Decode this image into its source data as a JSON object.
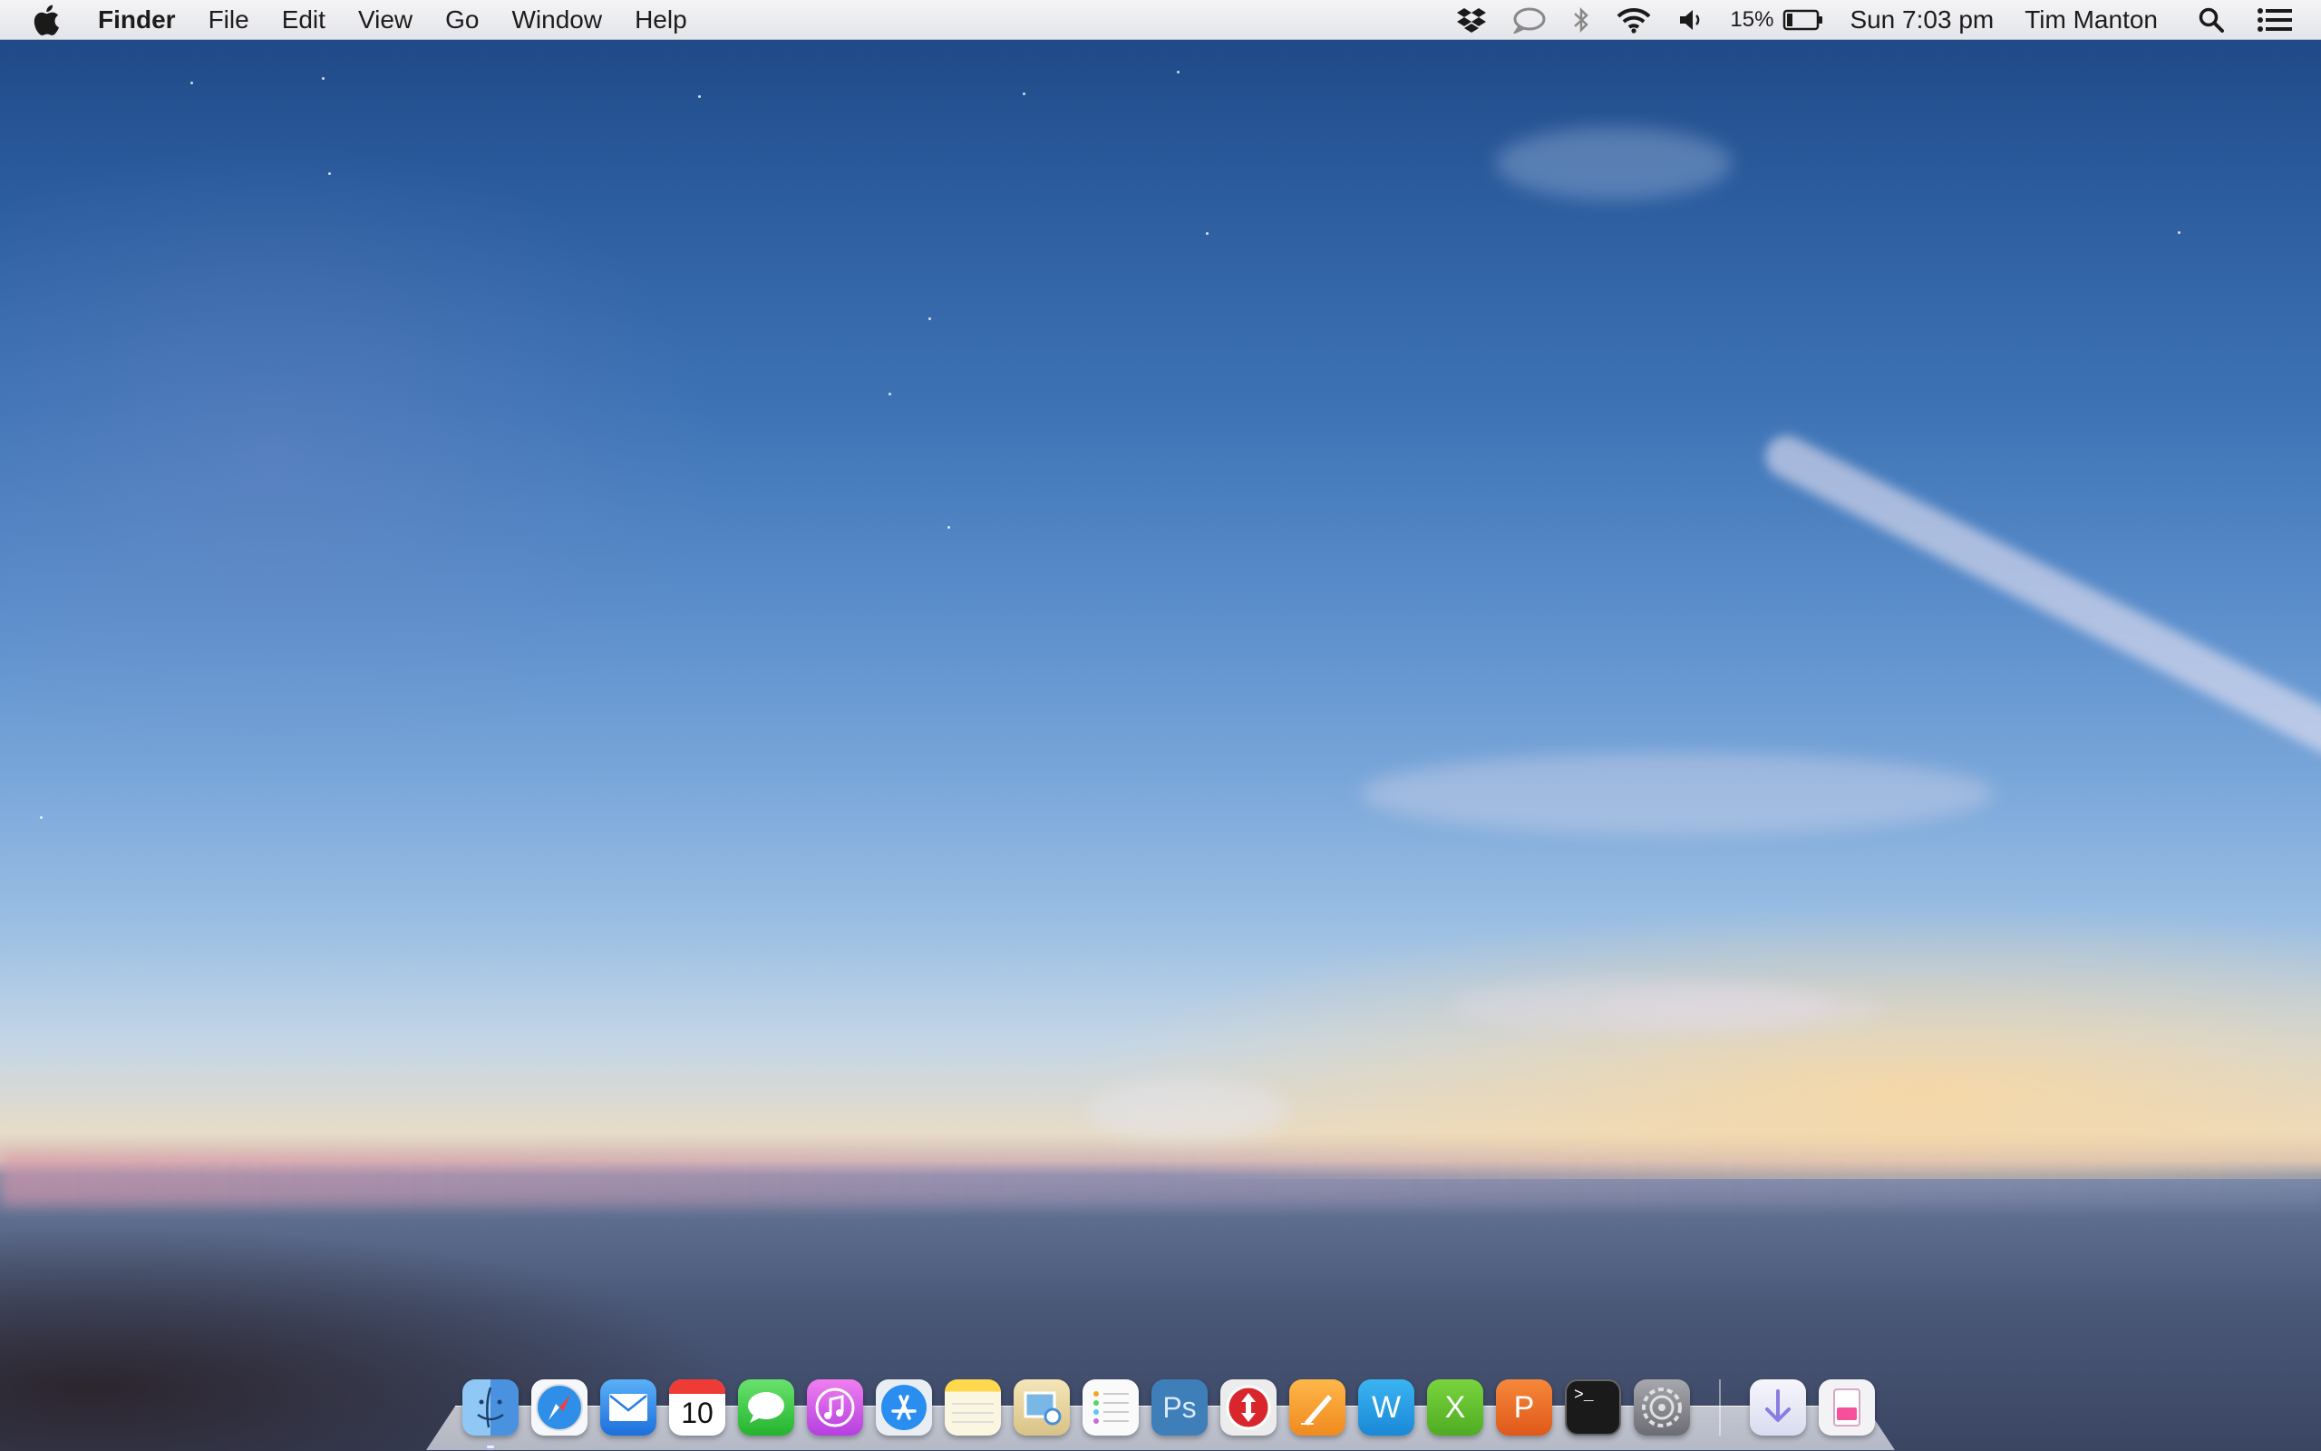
{
  "menubar": {
    "apple_icon": "apple-logo",
    "app_name": "Finder",
    "menus": [
      "File",
      "Edit",
      "View",
      "Go",
      "Window",
      "Help"
    ],
    "status_icons": [
      "dropbox-icon",
      "messages-status-icon",
      "bluetooth-icon",
      "wifi-icon",
      "volume-icon"
    ],
    "battery_percent": "15%",
    "clock": "Sun 7:03 pm",
    "user_name": "Tim Manton",
    "spotlight_icon": "search-icon",
    "notification_icon": "notification-center-icon"
  },
  "dock": {
    "apps": [
      {
        "name": "Finder",
        "icon": "finder-icon"
      },
      {
        "name": "Safari",
        "icon": "safari-icon"
      },
      {
        "name": "Mail",
        "icon": "mail-icon"
      },
      {
        "name": "Calendar",
        "icon": "calendar-icon",
        "date": "10"
      },
      {
        "name": "Messages",
        "icon": "messages-icon"
      },
      {
        "name": "iTunes",
        "icon": "itunes-icon"
      },
      {
        "name": "App Store",
        "icon": "app-store-icon"
      },
      {
        "name": "Notes",
        "icon": "notes-icon"
      },
      {
        "name": "Preview",
        "icon": "preview-icon"
      },
      {
        "name": "Reminders",
        "icon": "reminders-icon"
      },
      {
        "name": "Photoshop",
        "icon": "photoshop-icon",
        "glyph": "Ps"
      },
      {
        "name": "Transmit",
        "icon": "transmit-icon"
      },
      {
        "name": "Pages",
        "icon": "pages-icon"
      },
      {
        "name": "Word",
        "icon": "word-icon",
        "glyph": "W"
      },
      {
        "name": "Excel",
        "icon": "excel-icon",
        "glyph": "X"
      },
      {
        "name": "PowerPoint",
        "icon": "powerpoint-icon",
        "glyph": "P"
      },
      {
        "name": "Terminal",
        "icon": "terminal-icon",
        "glyph": ">_"
      },
      {
        "name": "System Preferences",
        "icon": "system-preferences-icon"
      }
    ],
    "stacks": [
      {
        "name": "Downloads",
        "icon": "downloads-stack-icon"
      },
      {
        "name": "Trash",
        "icon": "trash-icon"
      }
    ],
    "colors": {
      "finder": "#5aa8ee",
      "safari": "#2f8fe8",
      "mail": "#2b7de0",
      "calendar": "#ffffff",
      "messages": "#3fcf46",
      "itunes": "#d357ec",
      "appstore": "#2a8ef0",
      "notes": "#f7e9a8",
      "preview": "#e9d8a7",
      "reminders": "#fafafa",
      "photoshop": "#4f8ec6",
      "transmit": "#d9262c",
      "pages": "#f7a43a",
      "word": "#27a0e3",
      "excel": "#62c430",
      "powerpoint": "#ef7123",
      "terminal": "#1a1a1a",
      "sysprefs": "#8c8d92"
    }
  }
}
